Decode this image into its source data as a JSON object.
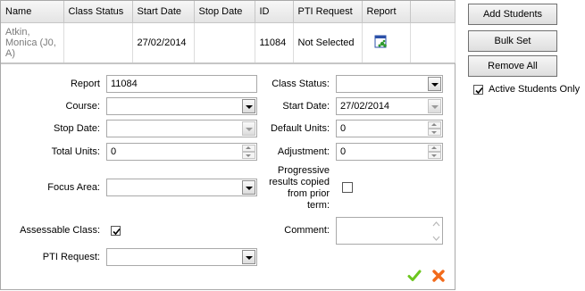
{
  "grid": {
    "columns": [
      "Name",
      "Class Status",
      "Start Date",
      "Stop Date",
      "ID",
      "PTI Request",
      "Report",
      ""
    ],
    "row": {
      "name": "Atkin, Monica (J0, A)",
      "class_status": "",
      "start_date": "27/02/2014",
      "stop_date": "",
      "id": "11084",
      "pti_request": "Not Selected",
      "report_icon": "report-icon"
    }
  },
  "form": {
    "report": {
      "label": "Report",
      "value": "11084"
    },
    "course": {
      "label": "Course:",
      "value": ""
    },
    "stop_date": {
      "label": "Stop Date:",
      "value": ""
    },
    "total_units": {
      "label": "Total Units:",
      "value": "0"
    },
    "focus_area": {
      "label": "Focus Area:",
      "value": ""
    },
    "assessable_class": {
      "label": "Assessable Class:",
      "checked": true
    },
    "pti_request": {
      "label": "PTI Request:",
      "value": ""
    },
    "class_status": {
      "label": "Class Status:",
      "value": ""
    },
    "start_date": {
      "label": "Start Date:",
      "value": "27/02/2014"
    },
    "default_units": {
      "label": "Default Units:",
      "value": "0"
    },
    "adjustment": {
      "label": "Adjustment:",
      "value": "0"
    },
    "progressive": {
      "label": "Progressive results copied from prior term:",
      "checked": false
    },
    "comment": {
      "label": "Comment:",
      "value": ""
    },
    "save_icon": "checkmark-icon",
    "cancel_icon": "cross-icon",
    "save_color": "#6cc61e",
    "cancel_color": "#f26a1b"
  },
  "actions": {
    "add_students": "Add Students",
    "bulk_set": "Bulk Set",
    "remove_all": "Remove All",
    "active_only": {
      "label": "Active Students Only",
      "checked": true
    }
  }
}
